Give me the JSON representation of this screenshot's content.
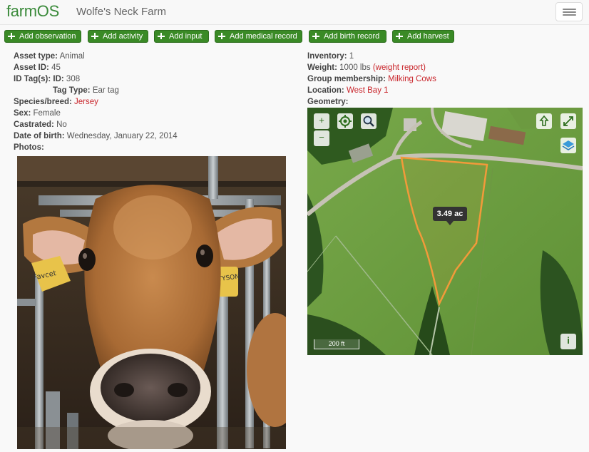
{
  "header": {
    "brand": "farmOS",
    "site_name": "Wolfe's Neck Farm"
  },
  "actions": [
    {
      "label": "Add observation"
    },
    {
      "label": "Add activity"
    },
    {
      "label": "Add input"
    },
    {
      "label": "Add medical record"
    },
    {
      "label": "Add birth record"
    },
    {
      "label": "Add harvest"
    }
  ],
  "asset": {
    "asset_type_label": "Asset type:",
    "asset_type": "Animal",
    "asset_id_label": "Asset ID:",
    "asset_id": "45",
    "id_tags_label": "ID Tag(s):",
    "id_label": "ID:",
    "id_value": "308",
    "tag_type_label": "Tag Type:",
    "tag_type": "Ear tag",
    "species_label": "Species/breed:",
    "species": "Jersey",
    "sex_label": "Sex:",
    "sex": "Female",
    "castrated_label": "Castrated:",
    "castrated": "No",
    "dob_label": "Date of birth:",
    "dob": "Wednesday, January 22, 2014",
    "photos_label": "Photos:"
  },
  "details": {
    "inventory_label": "Inventory:",
    "inventory": "1",
    "weight_label": "Weight:",
    "weight": "1000 lbs",
    "weight_report": "(weight report)",
    "group_label": "Group membership:",
    "group": "Milking Cows",
    "location_label": "Location:",
    "location": "West Bay 1",
    "geometry_label": "Geometry:"
  },
  "map": {
    "area_label": "3.49 ac",
    "scale_label": "200 ft",
    "zoom_in": "+",
    "zoom_out": "−",
    "info": "i",
    "icons": [
      "locate-icon",
      "search-icon",
      "upload-arrow-icon",
      "fullscreen-icon",
      "layers-icon"
    ]
  },
  "photo": {
    "ear_tag_text_left": "Favcet",
    "ear_tag_text_right": "TYSON"
  },
  "colors": {
    "brand_green": "#3a8a3a",
    "button_green": "#3a8a26",
    "link_red": "#c9252b",
    "polygon": "#f29a3a"
  }
}
